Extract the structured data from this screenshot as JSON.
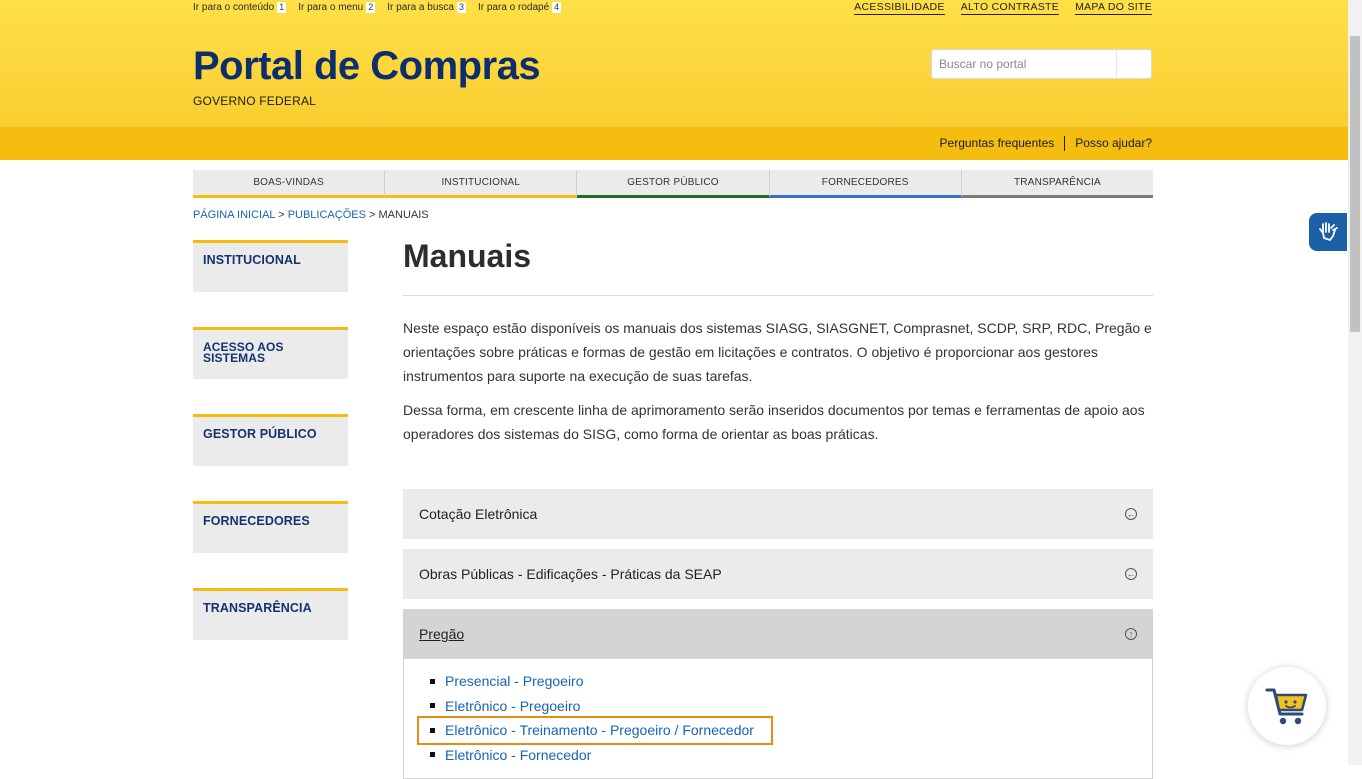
{
  "skip_links": [
    {
      "label": "Ir para o conteúdo",
      "key": "1"
    },
    {
      "label": "Ir para o menu",
      "key": "2"
    },
    {
      "label": "Ir para a busca",
      "key": "3"
    },
    {
      "label": "Ir para o rodapé",
      "key": "4"
    }
  ],
  "top_utility": [
    "ACESSIBILIDADE",
    "ALTO CONTRASTE",
    "MAPA DO SITE"
  ],
  "brand": {
    "title": "Portal de Compras",
    "subtitle": "GOVERNO FEDERAL"
  },
  "search": {
    "placeholder": "Buscar no portal",
    "value": ""
  },
  "band_links": [
    "Perguntas frequentes",
    "Posso ajudar?"
  ],
  "main_nav": [
    "BOAS-VINDAS",
    "INSTITUCIONAL",
    "GESTOR PÚBLICO",
    "FORNECEDORES",
    "TRANSPARÊNCIA"
  ],
  "breadcrumb": {
    "home": "PÁGINA INICIAL",
    "sep": ">",
    "section": "PUBLICAÇÕES",
    "current": "MANUAIS"
  },
  "sidebar": [
    "INSTITUCIONAL",
    "ACESSO AOS SISTEMAS",
    "GESTOR PÚBLICO",
    "FORNECEDORES",
    "TRANSPARÊNCIA"
  ],
  "page": {
    "title": "Manuais",
    "paragraphs": [
      "Neste espaço estão disponíveis os manuais dos sistemas SIASG, SIASGNET, Comprasnet, SCDP, SRP, RDC, Pregão e orientações sobre práticas e formas de gestão em licitações e contratos. O objetivo é proporcionar aos gestores instrumentos para suporte na execução de suas tarefas.",
      "Dessa forma, em crescente linha de aprimoramento serão inseridos documentos por temas e ferramentas de apoio aos operadores dos sistemas do SISG, como forma de orientar as boas práticas."
    ]
  },
  "accordion": [
    {
      "label": "Cotação Eletrônica",
      "icon": "expand-icon"
    },
    {
      "label": "Obras Públicas - Edificações - Práticas da SEAP",
      "icon": "expand-icon"
    },
    {
      "label": "Pregão",
      "icon": "collapse-icon",
      "items": [
        "Presencial - Pregoeiro",
        "Eletrônico - Pregoeiro",
        "Eletrônico - Treinamento - Pregoeiro / Fornecedor",
        "Eletrônico - Fornecedor"
      ]
    }
  ],
  "colors": {
    "brand_yellow": "#fcd53a",
    "band_yellow": "#f5bd10",
    "brand_blue": "#0d2e6e",
    "link_blue": "#1565b6",
    "highlight_orange": "#e98a12"
  }
}
